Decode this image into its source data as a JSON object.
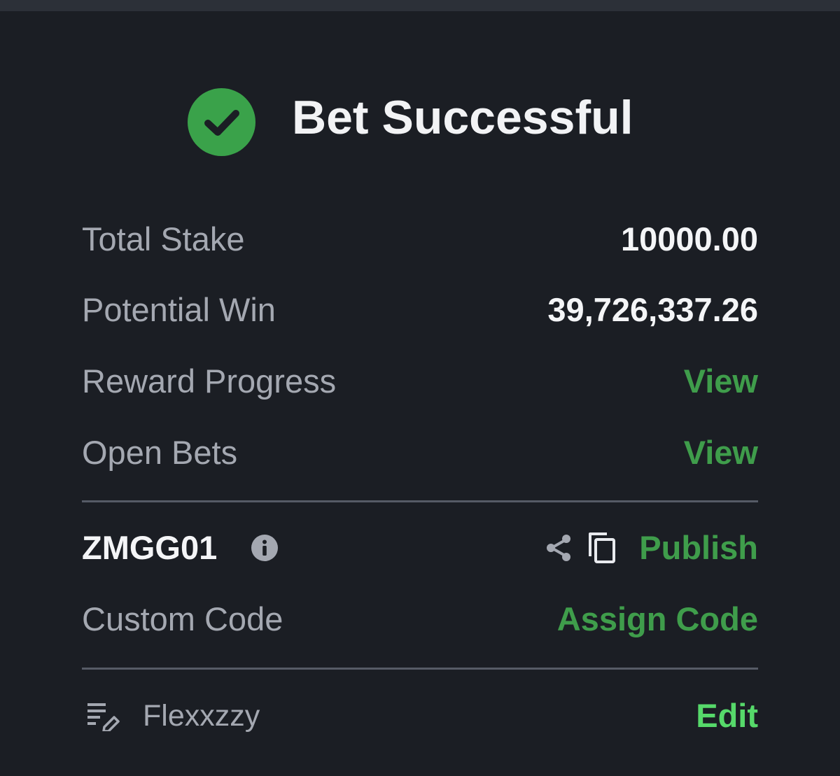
{
  "header": {
    "title": "Bet Successful",
    "status_icon": "check-circle-icon",
    "status_color": "#3aa24a"
  },
  "summary": {
    "total_stake_label": "Total Stake",
    "total_stake_value": "10000.00",
    "potential_win_label": "Potential Win",
    "potential_win_value": "39,726,337.26",
    "reward_progress_label": "Reward Progress",
    "reward_progress_link": "View",
    "open_bets_label": "Open Bets",
    "open_bets_link": "View"
  },
  "booking": {
    "code": "ZMGG01",
    "info_icon": "info-icon",
    "share_icon": "share-icon",
    "copy_icon": "copy-icon",
    "publish_label": "Publish",
    "custom_code_label": "Custom Code",
    "assign_code_label": "Assign Code"
  },
  "footer": {
    "edit_icon": "list-edit-icon",
    "username": "Flexxzzy",
    "edit_label": "Edit"
  },
  "colors": {
    "background": "#1b1e24",
    "accent_green": "#3f9d4b",
    "edit_green": "#56d96a",
    "label_gray": "#a4a8b1",
    "value_white": "#f4f5f7"
  }
}
